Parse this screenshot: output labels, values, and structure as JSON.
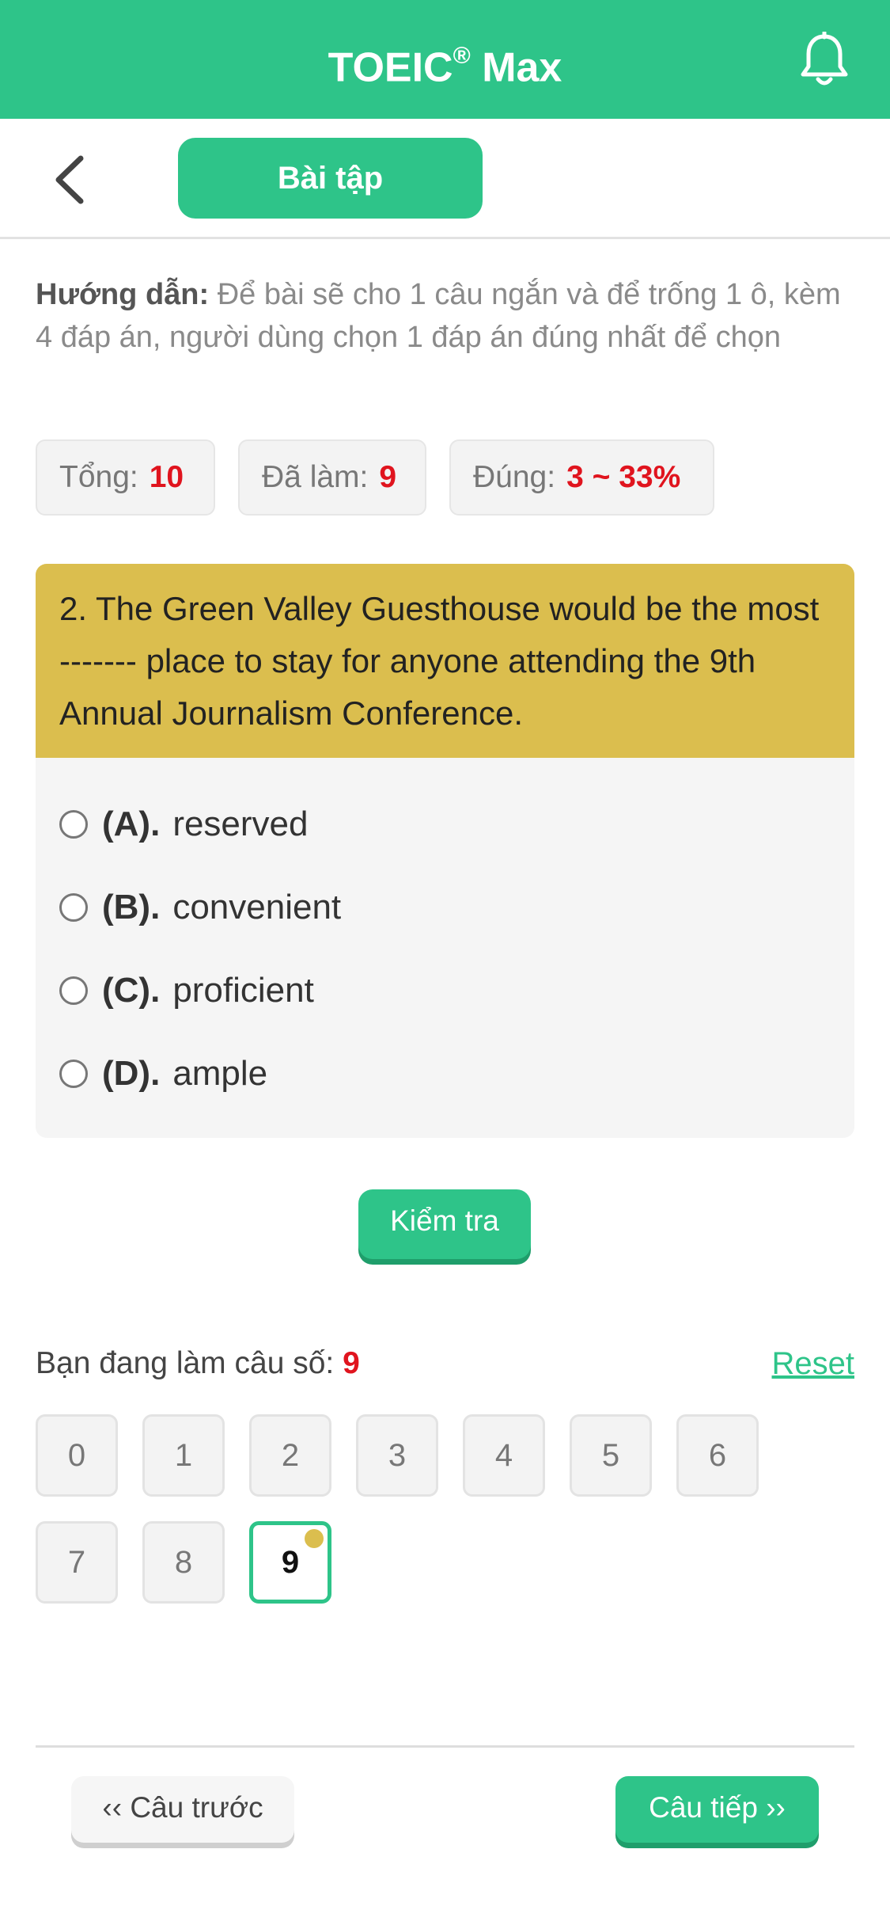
{
  "header": {
    "title": "TOEIC",
    "title_mark": "®",
    "title_suffix": "Max",
    "notification_icon": "bell-icon"
  },
  "subnav": {
    "back_icon": "chevron-left-icon",
    "tab_label": "Bài tập"
  },
  "guide": {
    "label": "Hướng dẫn:",
    "text": "Để bài sẽ cho 1 câu ngắn và để trống 1 ô, kèm 4 đáp án, người dùng chọn 1 đáp án đúng nhất để chọn"
  },
  "stats": {
    "total_label": "Tổng:",
    "total_value": "10",
    "done_label": "Đã làm:",
    "done_value": "9",
    "correct_label": "Đúng:",
    "correct_value": "3 ~ 33%"
  },
  "question": {
    "text": "2. The Green Valley Guesthouse would be the most ------- place to stay for anyone attending the 9th Annual Journalism Conference.",
    "options": [
      {
        "letter": "(A).",
        "text": "reserved"
      },
      {
        "letter": "(B).",
        "text": "convenient"
      },
      {
        "letter": "(C).",
        "text": "proficient"
      },
      {
        "letter": "(D).",
        "text": "ample"
      }
    ]
  },
  "check_button": "Kiểm tra",
  "progress": {
    "current_label": "Bạn đang làm câu số:",
    "current_value": "9",
    "reset_label": "Reset",
    "numbers": [
      "0",
      "1",
      "2",
      "3",
      "4",
      "5",
      "6",
      "7",
      "8",
      "9"
    ],
    "active_index": 9
  },
  "footer": {
    "prev_label": "‹‹ Câu trước",
    "next_label": "Câu tiếp ››"
  },
  "colors": {
    "primary": "#2ec489",
    "question_bg": "#dbbe4e",
    "highlight": "#e0141e"
  }
}
